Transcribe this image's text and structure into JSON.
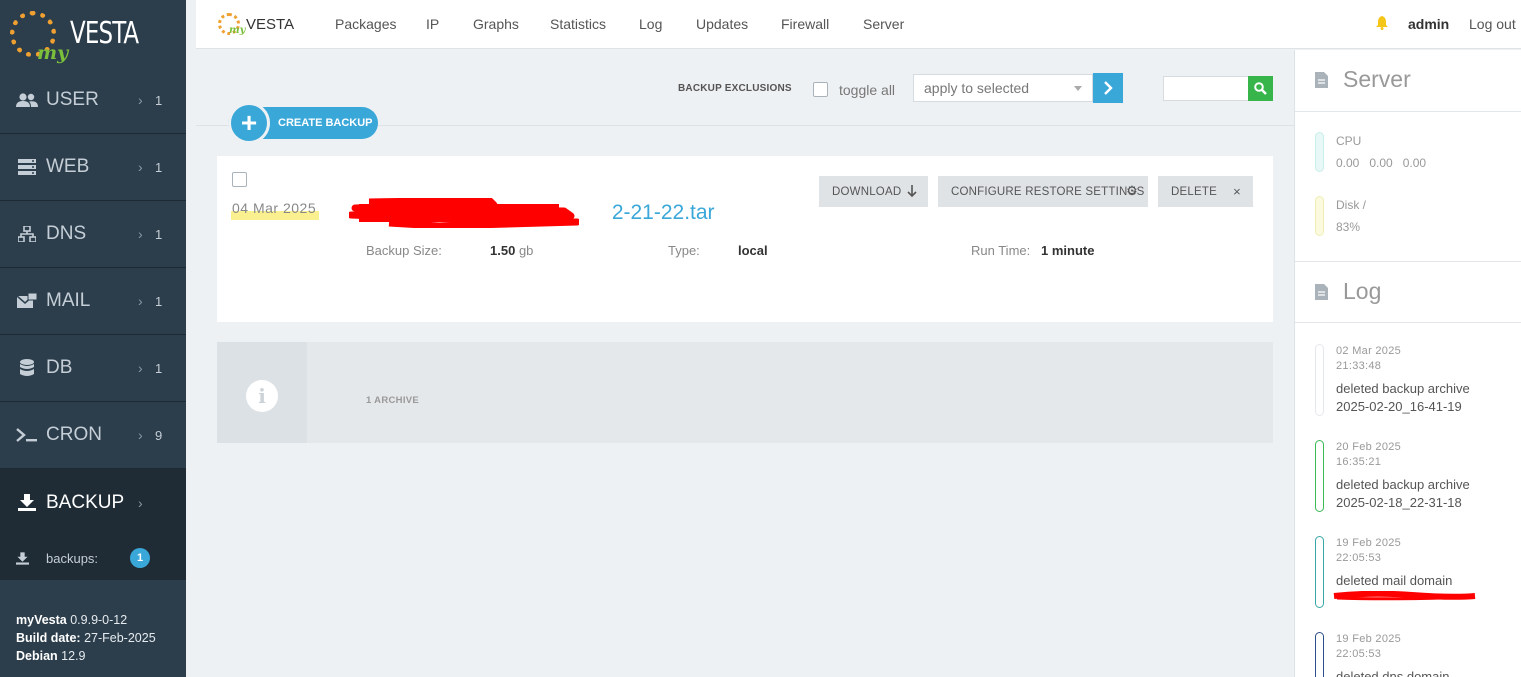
{
  "sidebar": {
    "logo_text": "VESTA",
    "logo_prefix": "my",
    "items": [
      {
        "label": "USER",
        "count": "1",
        "icon": "users-icon"
      },
      {
        "label": "WEB",
        "count": "1",
        "icon": "server-icon"
      },
      {
        "label": "DNS",
        "count": "1",
        "icon": "sitemap-icon"
      },
      {
        "label": "MAIL",
        "count": "1",
        "icon": "mail-icon"
      },
      {
        "label": "DB",
        "count": "1",
        "icon": "database-icon"
      },
      {
        "label": "CRON",
        "count": "9",
        "icon": "terminal-icon"
      },
      {
        "label": "BACKUP",
        "count": "",
        "icon": "download-icon"
      }
    ],
    "sub_item": {
      "label": "backups:",
      "badge": "1"
    },
    "footer": {
      "product_label": "myVesta",
      "version": "0.9.9-0-12",
      "build_label": "Build date:",
      "build_date": "27-Feb-2025",
      "os_label": "Debian",
      "os_version": "12.9"
    }
  },
  "topnav": {
    "logo_prefix": "my",
    "logo_text": "VESTA",
    "links": [
      "Packages",
      "IP",
      "Graphs",
      "Statistics",
      "Log",
      "Updates",
      "Firewall",
      "Server"
    ],
    "user": "admin",
    "logout": "Log out"
  },
  "toolbar": {
    "create_label": "CREATE BACKUP",
    "exclusions_label": "BACKUP EXCLUSIONS",
    "toggle_all": "toggle all",
    "bulk_select": "apply to selected"
  },
  "backup": {
    "date": "04  Mar  2025",
    "filename_visible": "2-21-22.tar",
    "actions": {
      "download": "DOWNLOAD",
      "configure": "CONFIGURE RESTORE SETTINGS",
      "delete": "DELETE"
    },
    "size_label": "Backup Size:",
    "size_value": "1.50",
    "size_unit": "gb",
    "type_label": "Type:",
    "type_value": "local",
    "runtime_label": "Run Time:",
    "runtime_value": "1 minute"
  },
  "archive_info": {
    "text": "1 ARCHIVE"
  },
  "right_panel": {
    "server_title": "Server",
    "cpu_label": "CPU",
    "cpu_values": "0.00   0.00   0.00",
    "disk_label": "Disk /",
    "disk_value": "83%",
    "log_title": "Log",
    "log_entries": [
      {
        "date": "02  Mar  2025",
        "time": "21:33:48",
        "msg1": "deleted backup archive",
        "msg2": "2025-02-20_16-41-19",
        "color": "#e5e8eb"
      },
      {
        "date": "20  Feb  2025",
        "time": "16:35:21",
        "msg1": "deleted backup archive",
        "msg2": "2025-02-18_22-31-18",
        "color": "#3cba54"
      },
      {
        "date": "19  Feb  2025",
        "time": "22:05:53",
        "msg1": "deleted mail domain",
        "msg2": "",
        "color": "#3aa7a7"
      },
      {
        "date": "19  Feb  2025",
        "time": "22:05:53",
        "msg1": "deleted dns domain",
        "msg2": "",
        "color": "#2b4e8c"
      }
    ]
  },
  "colors": {
    "accent": "#3aa7d9",
    "sidebar": "#2c3e4c",
    "search": "#38b54a",
    "redaction": "#ff0000"
  }
}
